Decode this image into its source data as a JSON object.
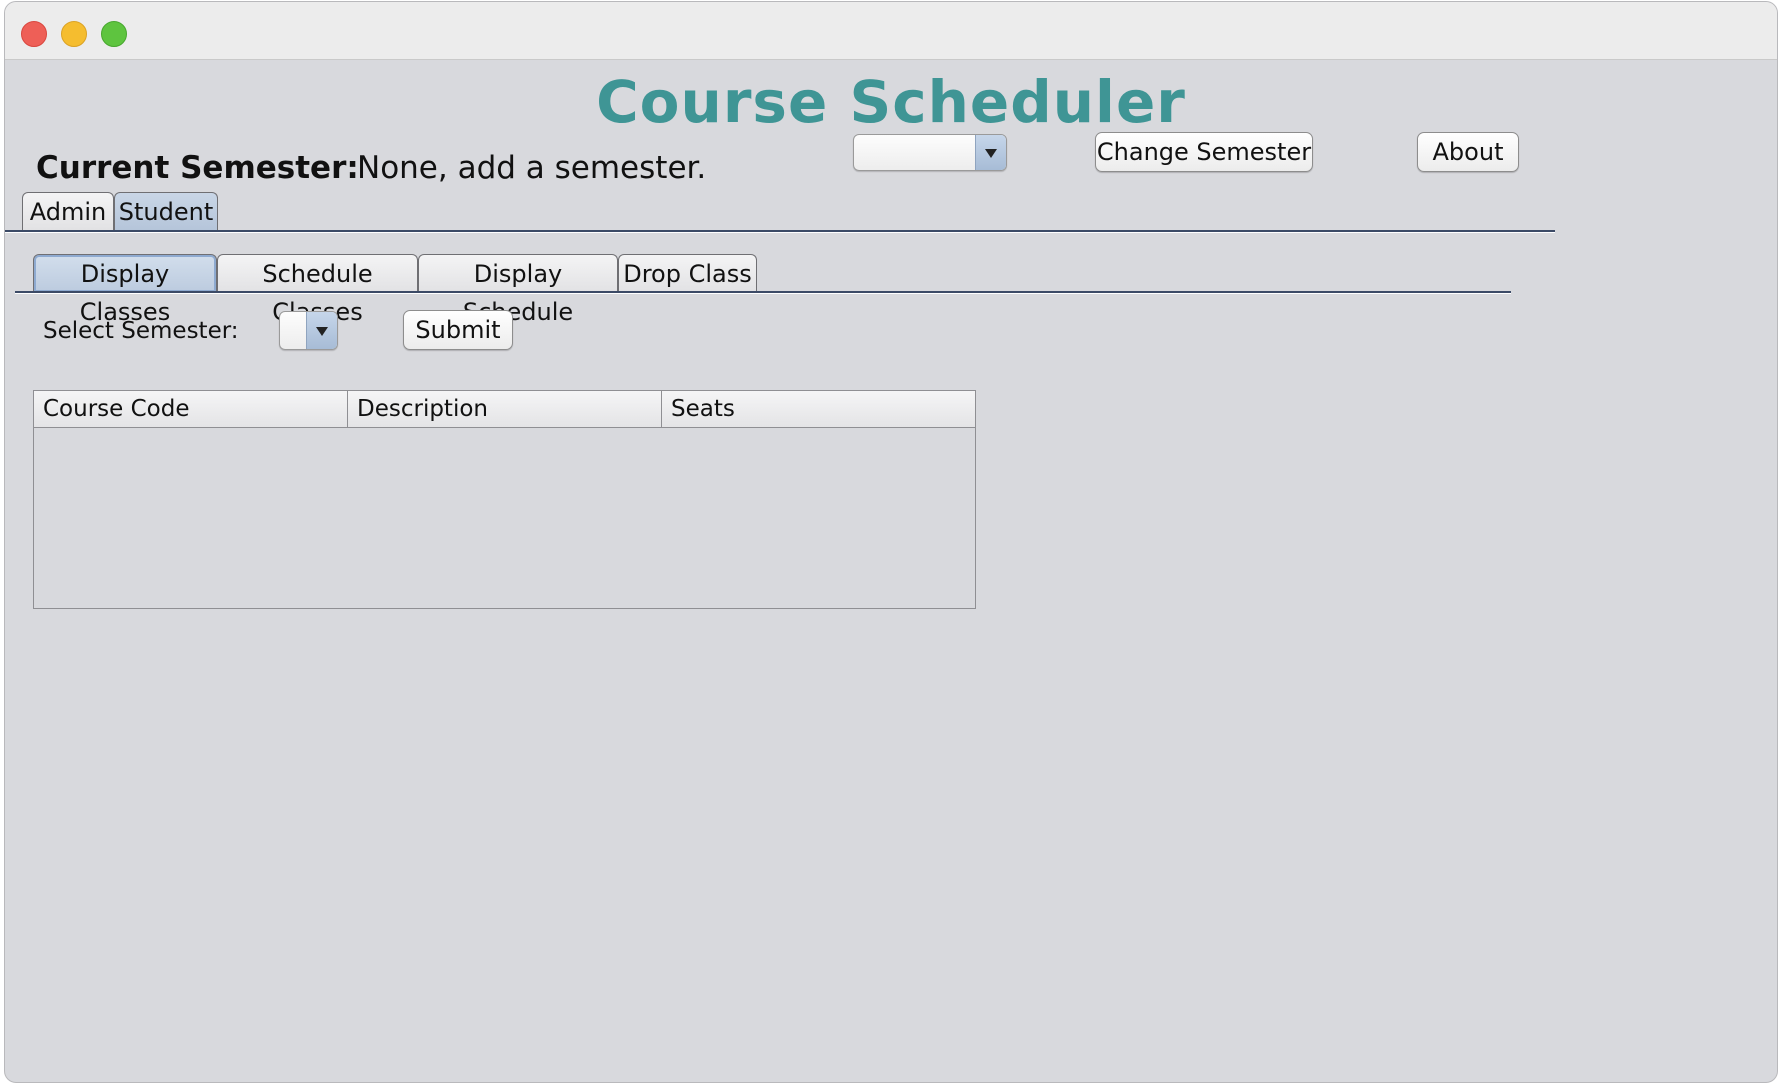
{
  "colors": {
    "accent": "#3f9595"
  },
  "window": {
    "controls": [
      "close",
      "minimize",
      "maximize"
    ]
  },
  "app": {
    "title": "Course Scheduler"
  },
  "header": {
    "current_semester_label": "Current Semester:",
    "current_semester_value": "None, add a semester.",
    "semester_combo_value": "",
    "change_semester_label": "Change Semester",
    "about_label": "About"
  },
  "main_tabs": [
    {
      "label": "Admin",
      "selected": false
    },
    {
      "label": "Student",
      "selected": true
    }
  ],
  "student_tabs": [
    {
      "label": "Display Classes",
      "selected": true
    },
    {
      "label": "Schedule Classes",
      "selected": false
    },
    {
      "label": "Display Schedule",
      "selected": false
    },
    {
      "label": "Drop Class",
      "selected": false
    }
  ],
  "display_classes": {
    "select_semester_label": "Select Semester:",
    "semester_value": "",
    "submit_label": "Submit",
    "table": {
      "columns": [
        "Course Code",
        "Description",
        "Seats"
      ],
      "rows": []
    }
  }
}
